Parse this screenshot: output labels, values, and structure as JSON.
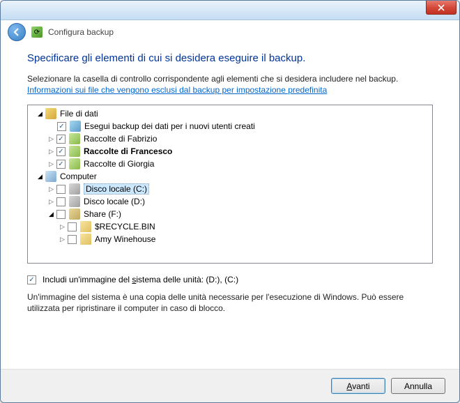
{
  "header": {
    "title": "Configura backup"
  },
  "headings": {
    "main": "Specificare gli elementi di cui si desidera eseguire il backup."
  },
  "description": "Selezionare la casella di controllo corrispondente agli elementi che si desidera includere nel backup.",
  "link": "Informazioni sui file che vengono esclusi dal backup per impostazione predefinita",
  "tree": {
    "file_di_dati": "File di dati",
    "esegui_backup": "Esegui backup dei dati per i nuovi utenti creati",
    "raccolte_fabrizio": "Raccolte di Fabrizio",
    "raccolte_francesco": "Raccolte di Francesco",
    "raccolte_giorgia": "Raccolte di Giorgia",
    "computer": "Computer",
    "disco_c": "Disco locale (C:)",
    "disco_d": "Disco locale (D:)",
    "share_f": "Share (F:)",
    "recycle": "$RECYCLE.BIN",
    "amy": "Amy Winehouse"
  },
  "system_image": {
    "label": "Includi un'immagine del sistema delle unità: (D:), (C:)",
    "desc": "Un'immagine del sistema è una copia delle unità necessarie per l'esecuzione di Windows. Può essere utilizzata per ripristinare il computer in caso di blocco."
  },
  "buttons": {
    "next": "Avanti",
    "next_key": "A",
    "cancel": "Annulla"
  }
}
